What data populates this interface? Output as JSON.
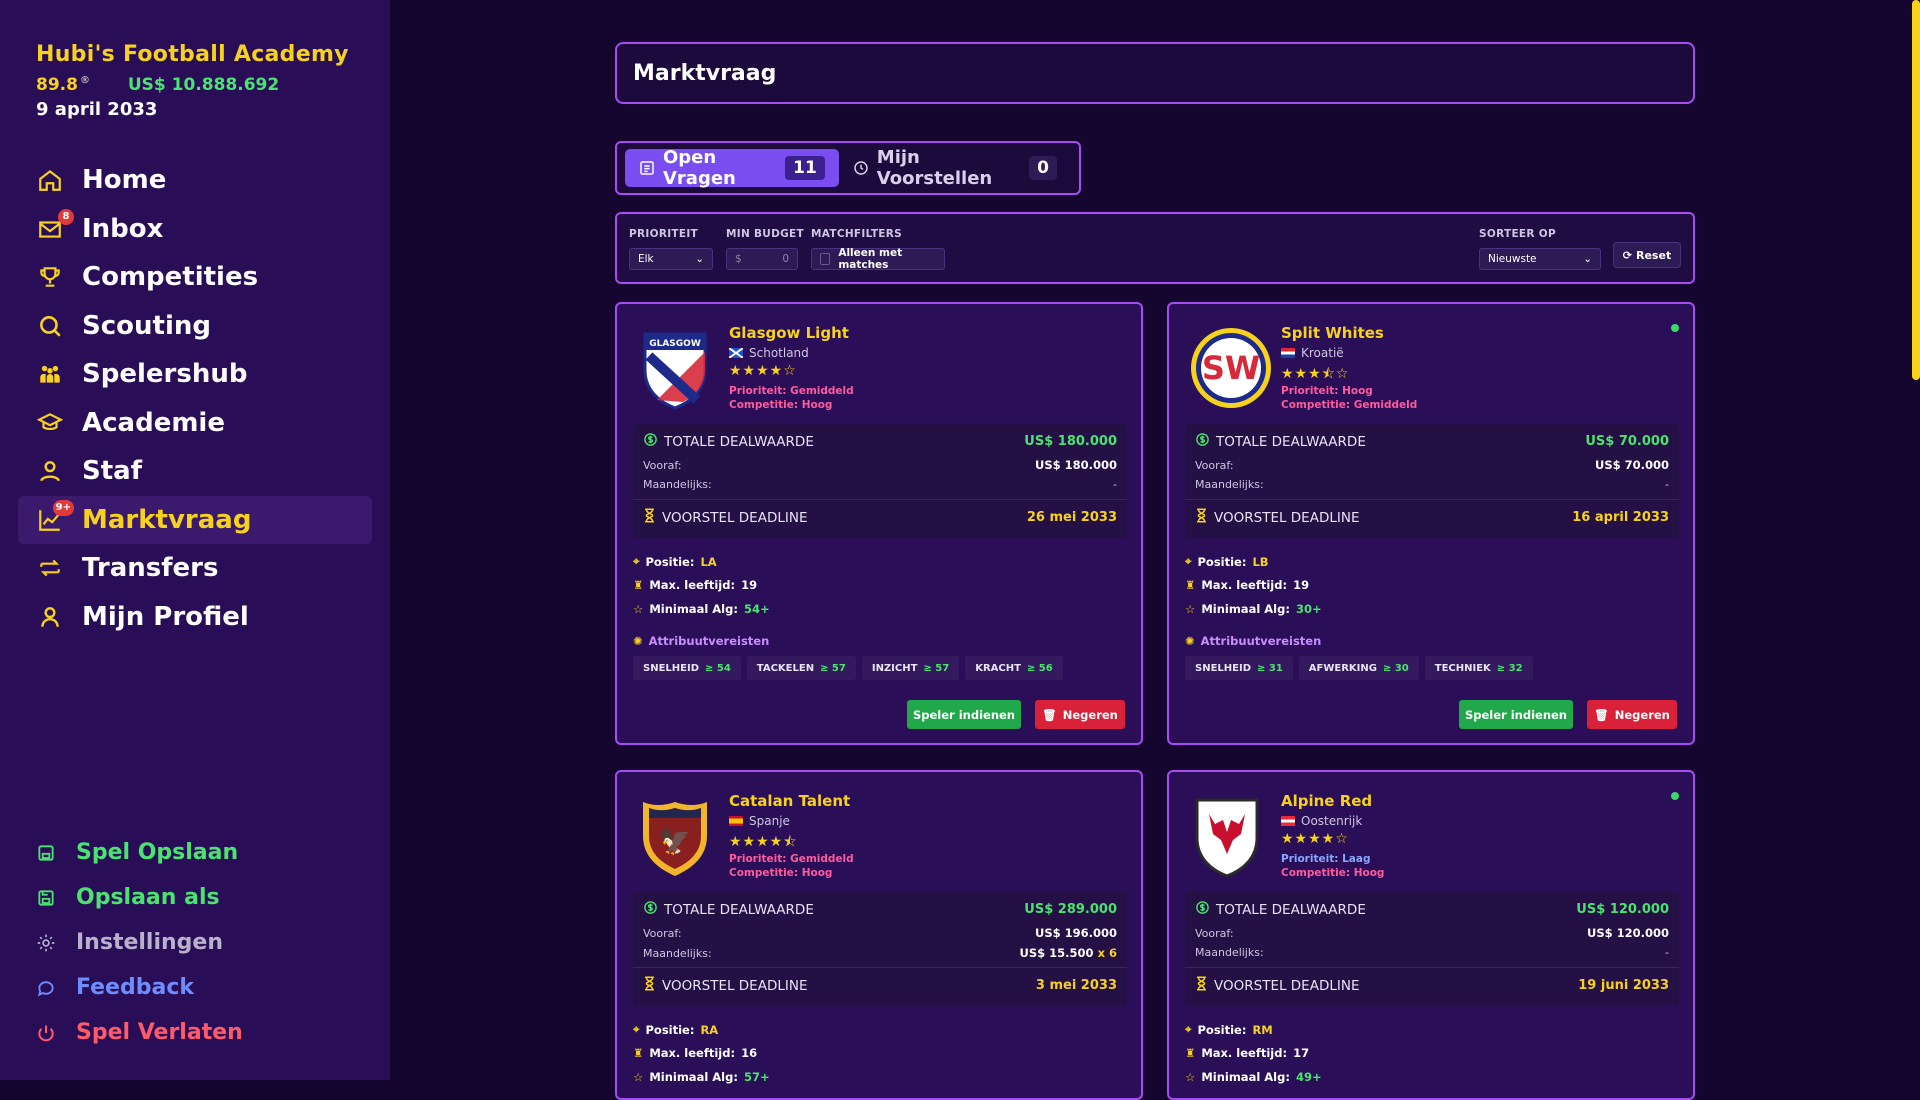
{
  "brand": {
    "title": "Hubi's Football Academy",
    "rating": "89.8",
    "rating_sup": "®",
    "money": "US$ 10.888.692",
    "date": "9 april 2033"
  },
  "nav": [
    {
      "label": "Home",
      "icon": "home-icon"
    },
    {
      "label": "Inbox",
      "icon": "mail-icon",
      "badge": "8"
    },
    {
      "label": "Competities",
      "icon": "trophy-icon"
    },
    {
      "label": "Scouting",
      "icon": "search-icon"
    },
    {
      "label": "Spelershub",
      "icon": "players-icon"
    },
    {
      "label": "Academie",
      "icon": "graduation-cap-icon"
    },
    {
      "label": "Staf",
      "icon": "staff-icon"
    },
    {
      "label": "Marktvraag",
      "icon": "chart-icon",
      "badge": "9+"
    },
    {
      "label": "Transfers",
      "icon": "transfer-icon"
    },
    {
      "label": "Mijn Profiel",
      "icon": "user-icon"
    }
  ],
  "bottom_nav": [
    {
      "label": "Spel Opslaan",
      "color": "#4ae36f"
    },
    {
      "label": "Opslaan als",
      "color": "#4ae36f"
    },
    {
      "label": "Instellingen",
      "color": "#b9b0cc"
    },
    {
      "label": "Feedback",
      "color": "#6f8cff"
    },
    {
      "label": "Spel Verlaten",
      "color": "#ff5a6a"
    }
  ],
  "page_title": "Marktvraag",
  "tabs": {
    "open": {
      "label": "Open Vragen",
      "count": "11"
    },
    "mine": {
      "label": "Mijn Voorstellen",
      "count": "0"
    }
  },
  "filters": {
    "prioriteit_label": "PRIORITEIT",
    "prioriteit_value": "Elk",
    "budget_label": "MIN BUDGET",
    "budget_prefix": "$",
    "budget_value": "0",
    "match_label": "MATCHFILTERS",
    "match_checkbox": "Alleen met matches",
    "sort_label": "SORTEER OP",
    "sort_value": "Nieuwste",
    "reset": "Reset"
  },
  "labels": {
    "total": "TOTALE DEALWAARDE",
    "upfront": "Vooraf:",
    "monthly": "Maandelijks:",
    "deadline": "VOORSTEL DEADLINE",
    "position": "Positie:",
    "max_age": "Max. leeftijd:",
    "min_overall": "Minimaal Alg:",
    "attributes": "Attribuutvereisten",
    "submit": "Speler indienen",
    "ignore": "Negeren"
  },
  "cards": [
    {
      "club": "Glasgow Light",
      "country": "Schotland",
      "stars": "★★★★☆",
      "priority": "Prioriteit: Gemiddeld",
      "priority_color": "#ff5a9e",
      "competition": "Competitie: Hoog",
      "total": "US$ 180.000",
      "upfront": "US$ 180.000",
      "monthly": "-",
      "monthly_mult": "",
      "deadline": "26 mei 2033",
      "position": "LA",
      "max_age": "19",
      "min_overall": "54+",
      "attrs": [
        {
          "name": "SNELHEID",
          "val": "≥ 54"
        },
        {
          "name": "TACKELEN",
          "val": "≥ 57"
        },
        {
          "name": "INZICHT",
          "val": "≥ 57"
        },
        {
          "name": "KRACHT",
          "val": "≥ 56"
        }
      ],
      "dot": false
    },
    {
      "club": "Split Whites",
      "country": "Kroatië",
      "stars": "★★★⯪☆",
      "priority": "Prioriteit: Hoog",
      "priority_color": "#ff5a9e",
      "competition": "Competitie: Gemiddeld",
      "total": "US$ 70.000",
      "upfront": "US$ 70.000",
      "monthly": "-",
      "monthly_mult": "",
      "deadline": "16 april 2033",
      "position": "LB",
      "max_age": "19",
      "min_overall": "30+",
      "attrs": [
        {
          "name": "SNELHEID",
          "val": "≥ 31"
        },
        {
          "name": "AFWERKING",
          "val": "≥ 30"
        },
        {
          "name": "TECHNIEK",
          "val": "≥ 32"
        }
      ],
      "dot": true
    },
    {
      "club": "Catalan Talent",
      "country": "Spanje",
      "stars": "★★★★⯪",
      "priority": "Prioriteit: Gemiddeld",
      "priority_color": "#ff5a9e",
      "competition": "Competitie: Hoog",
      "total": "US$ 289.000",
      "upfront": "US$ 196.000",
      "monthly": "US$ 15.500",
      "monthly_mult": "x 6",
      "deadline": "3 mei 2033",
      "position": "RA",
      "max_age": "16",
      "min_overall": "57+",
      "attrs": [],
      "dot": false
    },
    {
      "club": "Alpine Red",
      "country": "Oostenrijk",
      "stars": "★★★★☆",
      "priority": "Prioriteit: Laag",
      "priority_color": "#8aa6ff",
      "competition": "Competitie: Hoog",
      "total": "US$ 120.000",
      "upfront": "US$ 120.000",
      "monthly": "-",
      "monthly_mult": "",
      "deadline": "19 juni 2033",
      "position": "RM",
      "max_age": "17",
      "min_overall": "49+",
      "attrs": [],
      "dot": true
    }
  ]
}
